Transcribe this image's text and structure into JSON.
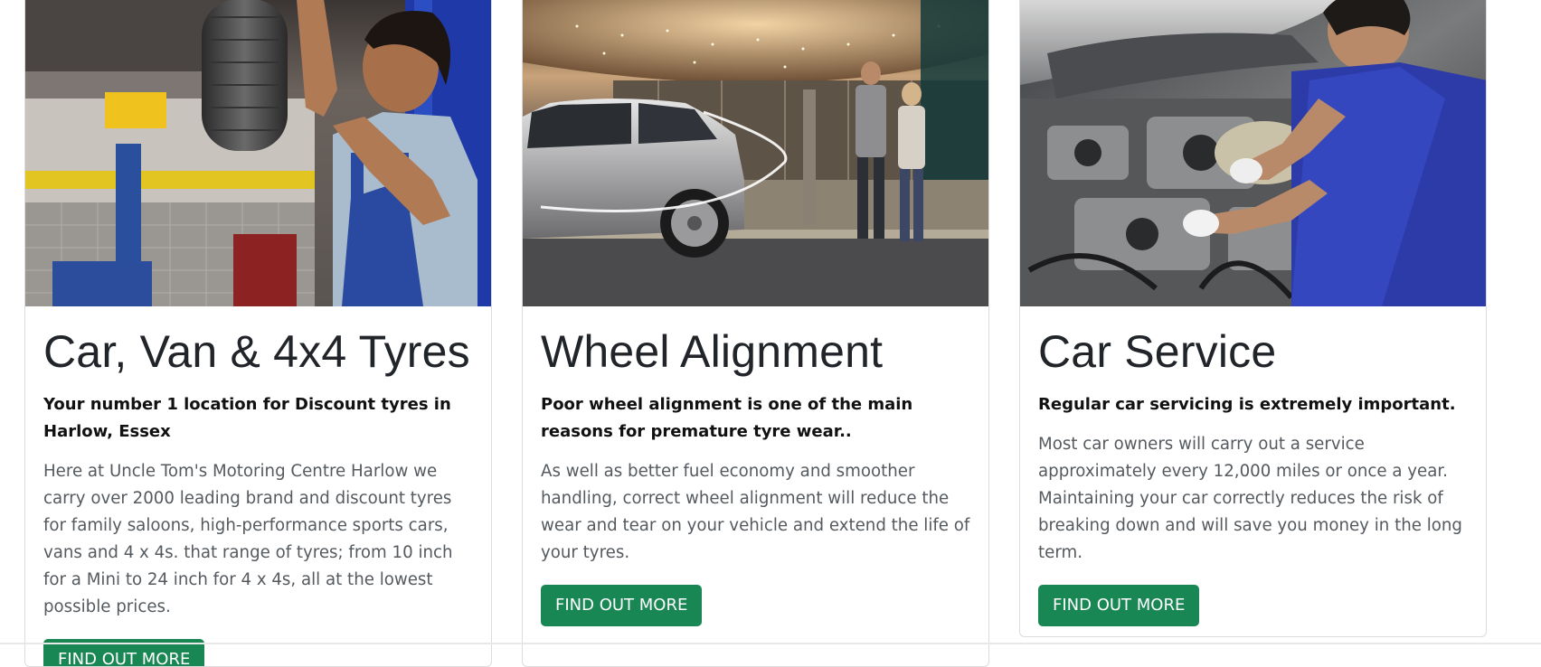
{
  "cards": [
    {
      "title": "Car, Van & 4x4 Tyres",
      "subtitle": "Your number 1 location for Discount tyres in Harlow, Essex",
      "text": "Here at Uncle Tom's Motoring Centre Harlow we carry over 2000 leading brand and discount tyres for family saloons, high-performance sports cars, vans and 4 x 4s. that range of tyres; from 10 inch for a Mini to 24 inch for 4 x 4s, all at the lowest possible prices.",
      "button": "FIND OUT MORE",
      "image": "mechanic-fitting-tyre-photo"
    },
    {
      "title": "Wheel Alignment",
      "subtitle": "Poor wheel alignment is one of the main reasons for premature tyre wear..",
      "text": "As well as better fuel economy and smoother handling, correct wheel alignment will reduce the wear and tear on your vehicle and extend the life of your tyres.",
      "button": "FIND OUT MORE",
      "image": "silver-hatchback-couple-night-photo"
    },
    {
      "title": "Car Service",
      "subtitle": "Regular car servicing is extremely important.",
      "text": "Most car owners will carry out a service approximately every 12,000 miles or once a year. Maintaining your car correctly reduces the risk of breaking down and will save you money in the long term.",
      "button": "FIND OUT MORE",
      "image": "mechanic-engine-bay-photo"
    }
  ],
  "colors": {
    "button_bg": "#198754",
    "button_text": "#ffffff",
    "title": "#212529",
    "body_text": "#555a5f"
  }
}
